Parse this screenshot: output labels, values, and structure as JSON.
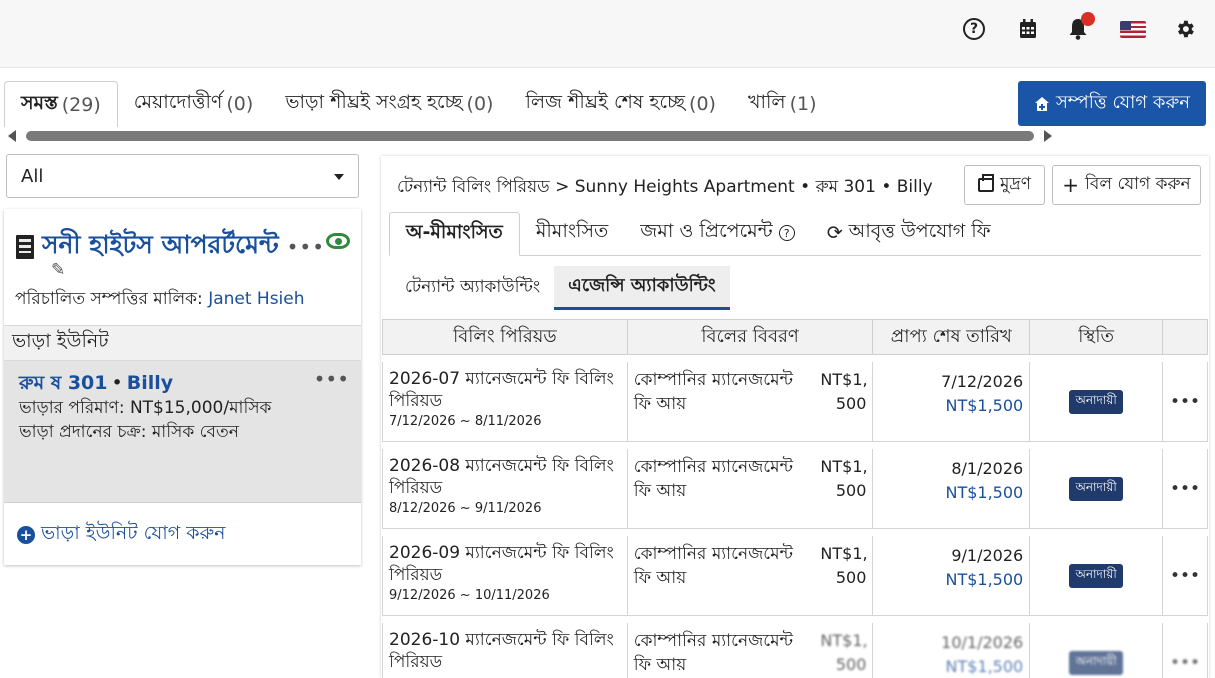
{
  "topbar": {
    "icons": [
      "help-icon",
      "calendar-icon",
      "bell-icon",
      "us-flag-icon",
      "gear-icon"
    ],
    "help_glyph": "?"
  },
  "property_tabs": [
    {
      "label": "সমস্ত",
      "count": "(29)"
    },
    {
      "label": "মেয়াদোত্তীর্ণ",
      "count": "(0)"
    },
    {
      "label": "ভাড়া শীঘ্রই সংগ্রহ হচ্ছে",
      "count": "(0)"
    },
    {
      "label": "লিজ শীঘ্রই শেষ হচ্ছে",
      "count": "(0)"
    },
    {
      "label": "খালি",
      "count": "(1)"
    }
  ],
  "add_property_button": "সম্পত্তি যোগ করুন",
  "filter": {
    "selected": "All"
  },
  "property": {
    "name": "সনী হাইটস আপরর্টমেন্ট",
    "owner_label": "পরিচালিত সম্পত্তির মালিক:",
    "owner_name": "Janet Hsieh",
    "rent_units_header": "ভাড়া ইউনিট",
    "unit": {
      "room": "রুম ষ 301",
      "tenant": "Billy",
      "rent_amount": "ভাড়ার পরিমাণ: NT$15,000/মাসিক",
      "rent_cycle": "ভাড়া প্রদানের চক্র: মাসিক বেতন"
    },
    "add_unit": "ভাড়া ইউনিট যোগ করুন"
  },
  "breadcrumb": {
    "root": "টেন্যান্ট বিলিং পিরিয়ড",
    "separator": ">",
    "property": "Sunny Heights Apartment",
    "dot": "•",
    "room": "রুম 301",
    "tenant": "Billy"
  },
  "actions": {
    "print": "মুদ্রণ",
    "add_bill": "বিল যোগ করুন"
  },
  "sub_tabs": [
    {
      "label": "অ-মীমাংসিত"
    },
    {
      "label": "মীমাংসিত"
    },
    {
      "label": "জমা ও প্রিপেমেন্ট"
    },
    {
      "label": "আবৃত্ত উপযোগ ফি"
    }
  ],
  "account_tabs": [
    {
      "label": "টেন্যান্ট অ্যাকাউন্টিং"
    },
    {
      "label": "এজেন্সি অ্যাকাউন্টিং"
    }
  ],
  "table": {
    "headers": [
      "বিলিং পিরিয়ড",
      "বিলের বিবরণ",
      "প্রাপ্য শেষ তারিখ",
      "স্থিতি"
    ],
    "more_glyph": "•••",
    "rows": [
      {
        "title": "2026-07 ম্যানেজমেন্ট ফি বিলিং পিরিয়ড",
        "range": "7/12/2026 ~ 8/11/2026",
        "desc": "কোম্পানির ম্যানেজমেন্ট ফি আয়",
        "amount": "NT$1, 500",
        "due_date": "7/12/2026",
        "due_amount": "NT$1,500",
        "status": "অনাদায়ী"
      },
      {
        "title": "2026-08 ম্যানেজমেন্ট ফি বিলিং পিরিয়ড",
        "range": "8/12/2026 ~ 9/11/2026",
        "desc": "কোম্পানির ম্যানেজমেন্ট ফি আয়",
        "amount": "NT$1, 500",
        "due_date": "8/1/2026",
        "due_amount": "NT$1,500",
        "status": "অনাদায়ী"
      },
      {
        "title": "2026-09 ম্যানেজমেন্ট ফি বিলিং পিরিয়ড",
        "range": "9/12/2026 ~ 10/11/2026",
        "desc": "কোম্পানির ম্যানেজমেন্ট ফি আয়",
        "amount": "NT$1, 500",
        "due_date": "9/1/2026",
        "due_amount": "NT$1,500",
        "status": "অনাদায়ী"
      },
      {
        "title": "2026-10 ম্যানেজমেন্ট ফি বিলিং পিরিয়ড",
        "range": "",
        "desc": "কোম্পানির ম্যানেজমেন্ট ফি আয়",
        "amount": "NT$1, 500",
        "due_date": "10/1/2026",
        "due_amount": "NT$1,500",
        "status": "অনাদায়ী"
      }
    ]
  },
  "colors": {
    "accent": "#1a55a8",
    "link": "#1a4f9c",
    "badge": "#1f3a6b",
    "eye": "#2e8b3e",
    "notification": "#d93025"
  }
}
